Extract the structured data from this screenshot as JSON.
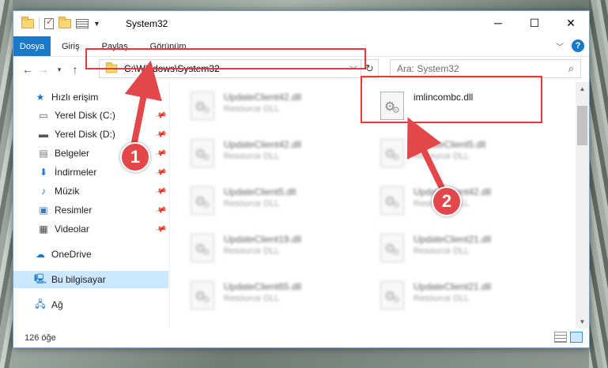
{
  "window": {
    "title": "System32",
    "controls": {
      "minimize": "─",
      "maximize": "☐",
      "close": "✕"
    }
  },
  "ribbon": {
    "tabs": [
      "Dosya",
      "Giriş",
      "Paylaş",
      "Görünüm"
    ]
  },
  "nav": {
    "address": "C:\\Windows\\System32",
    "search_placeholder": "Ara: System32"
  },
  "sidebar": {
    "items": [
      {
        "label": "Hızlı erişim",
        "icon": "star-icon"
      },
      {
        "label": "Yerel Disk (C:)",
        "icon": "drive-icon",
        "pinned": true
      },
      {
        "label": "Yerel Disk (D:)",
        "icon": "drive-icon",
        "pinned": true
      },
      {
        "label": "Belgeler",
        "icon": "documents-icon",
        "pinned": true
      },
      {
        "label": "İndirmeler",
        "icon": "download-icon",
        "pinned": true
      },
      {
        "label": "Müzik",
        "icon": "music-icon",
        "pinned": true
      },
      {
        "label": "Resimler",
        "icon": "pictures-icon",
        "pinned": true
      },
      {
        "label": "Videolar",
        "icon": "video-icon",
        "pinned": true
      },
      {
        "label": "OneDrive",
        "icon": "cloud-icon"
      },
      {
        "label": "Bu bilgisayar",
        "icon": "computer-icon",
        "selected": true
      },
      {
        "label": "Ağ",
        "icon": "network-icon"
      }
    ]
  },
  "files": [
    {
      "name": "UpdateClient42.dll",
      "type": "Resource DLL"
    },
    {
      "name": "imlincombc.dll",
      "type": ""
    },
    {
      "name": "UpdateClient42.dll",
      "type": "Resource DLL"
    },
    {
      "name": "UpdateClient5.dll",
      "type": "Resource DLL"
    },
    {
      "name": "UpdateClient5.dll",
      "type": "Resource DLL"
    },
    {
      "name": "UpdateClient42.dll",
      "type": "Resource DLL"
    },
    {
      "name": "UpdateClient19.dll",
      "type": "Resource DLL"
    },
    {
      "name": "UpdateClient21.dll",
      "type": "Resource DLL"
    },
    {
      "name": "UpdateClient65.dll",
      "type": "Resource DLL"
    },
    {
      "name": "UpdateClient21.dll",
      "type": "Resource DLL"
    }
  ],
  "status": {
    "count": "126 öğe"
  },
  "callouts": {
    "one": "1",
    "two": "2"
  },
  "colors": {
    "accent": "#1979ca",
    "highlight": "#e63939"
  }
}
